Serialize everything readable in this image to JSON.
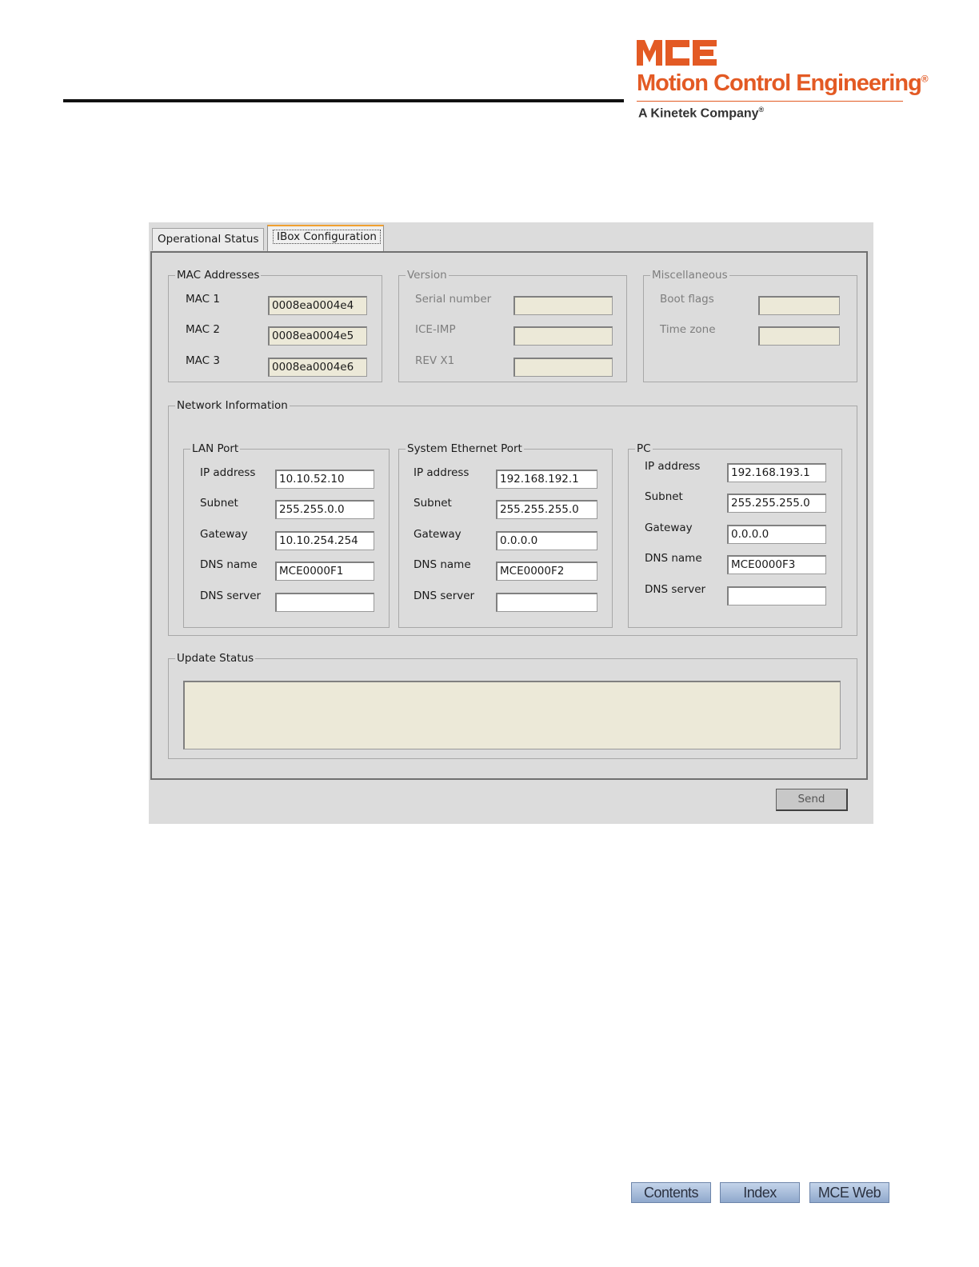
{
  "brand": {
    "name": "Motion Control Engineering",
    "tagline": "A Kinetek Company",
    "color": "#e35a24"
  },
  "tabs": [
    {
      "label": "Operational Status",
      "active": false
    },
    {
      "label": "IBox Configuration",
      "active": true
    }
  ],
  "mac": {
    "legend": "MAC Addresses",
    "rows": [
      {
        "label": "MAC 1",
        "value": "0008ea0004e4"
      },
      {
        "label": "MAC 2",
        "value": "0008ea0004e5"
      },
      {
        "label": "MAC 3",
        "value": "0008ea0004e6"
      }
    ]
  },
  "version": {
    "legend": "Version",
    "rows": [
      {
        "label": "Serial number",
        "value": ""
      },
      {
        "label": "ICE-IMP",
        "value": ""
      },
      {
        "label": "REV X1",
        "value": ""
      }
    ]
  },
  "misc": {
    "legend": "Miscellaneous",
    "rows": [
      {
        "label": "Boot flags",
        "value": ""
      },
      {
        "label": "Time zone",
        "value": ""
      }
    ]
  },
  "network": {
    "legend": "Network Information",
    "lan": {
      "legend": "LAN Port",
      "rows": [
        {
          "label": "IP address",
          "value": "10.10.52.10"
        },
        {
          "label": "Subnet",
          "value": "255.255.0.0"
        },
        {
          "label": "Gateway",
          "value": "10.10.254.254"
        },
        {
          "label": "DNS name",
          "value": "MCE0000F1"
        },
        {
          "label": "DNS server",
          "value": ""
        }
      ]
    },
    "sys": {
      "legend": "System Ethernet Port",
      "rows": [
        {
          "label": "IP address",
          "value": "192.168.192.1"
        },
        {
          "label": "Subnet",
          "value": "255.255.255.0"
        },
        {
          "label": "Gateway",
          "value": "0.0.0.0"
        },
        {
          "label": "DNS name",
          "value": "MCE0000F2"
        },
        {
          "label": "DNS server",
          "value": ""
        }
      ]
    },
    "pc": {
      "legend": "PC",
      "rows": [
        {
          "label": "IP address",
          "value": "192.168.193.1"
        },
        {
          "label": "Subnet",
          "value": "255.255.255.0"
        },
        {
          "label": "Gateway",
          "value": "0.0.0.0"
        },
        {
          "label": "DNS name",
          "value": "MCE0000F3"
        },
        {
          "label": "DNS server",
          "value": ""
        }
      ]
    }
  },
  "update": {
    "legend": "Update Status",
    "text": ""
  },
  "send_label": "Send",
  "nav": {
    "contents": "Contents",
    "index": "Index",
    "web": "MCE Web"
  }
}
